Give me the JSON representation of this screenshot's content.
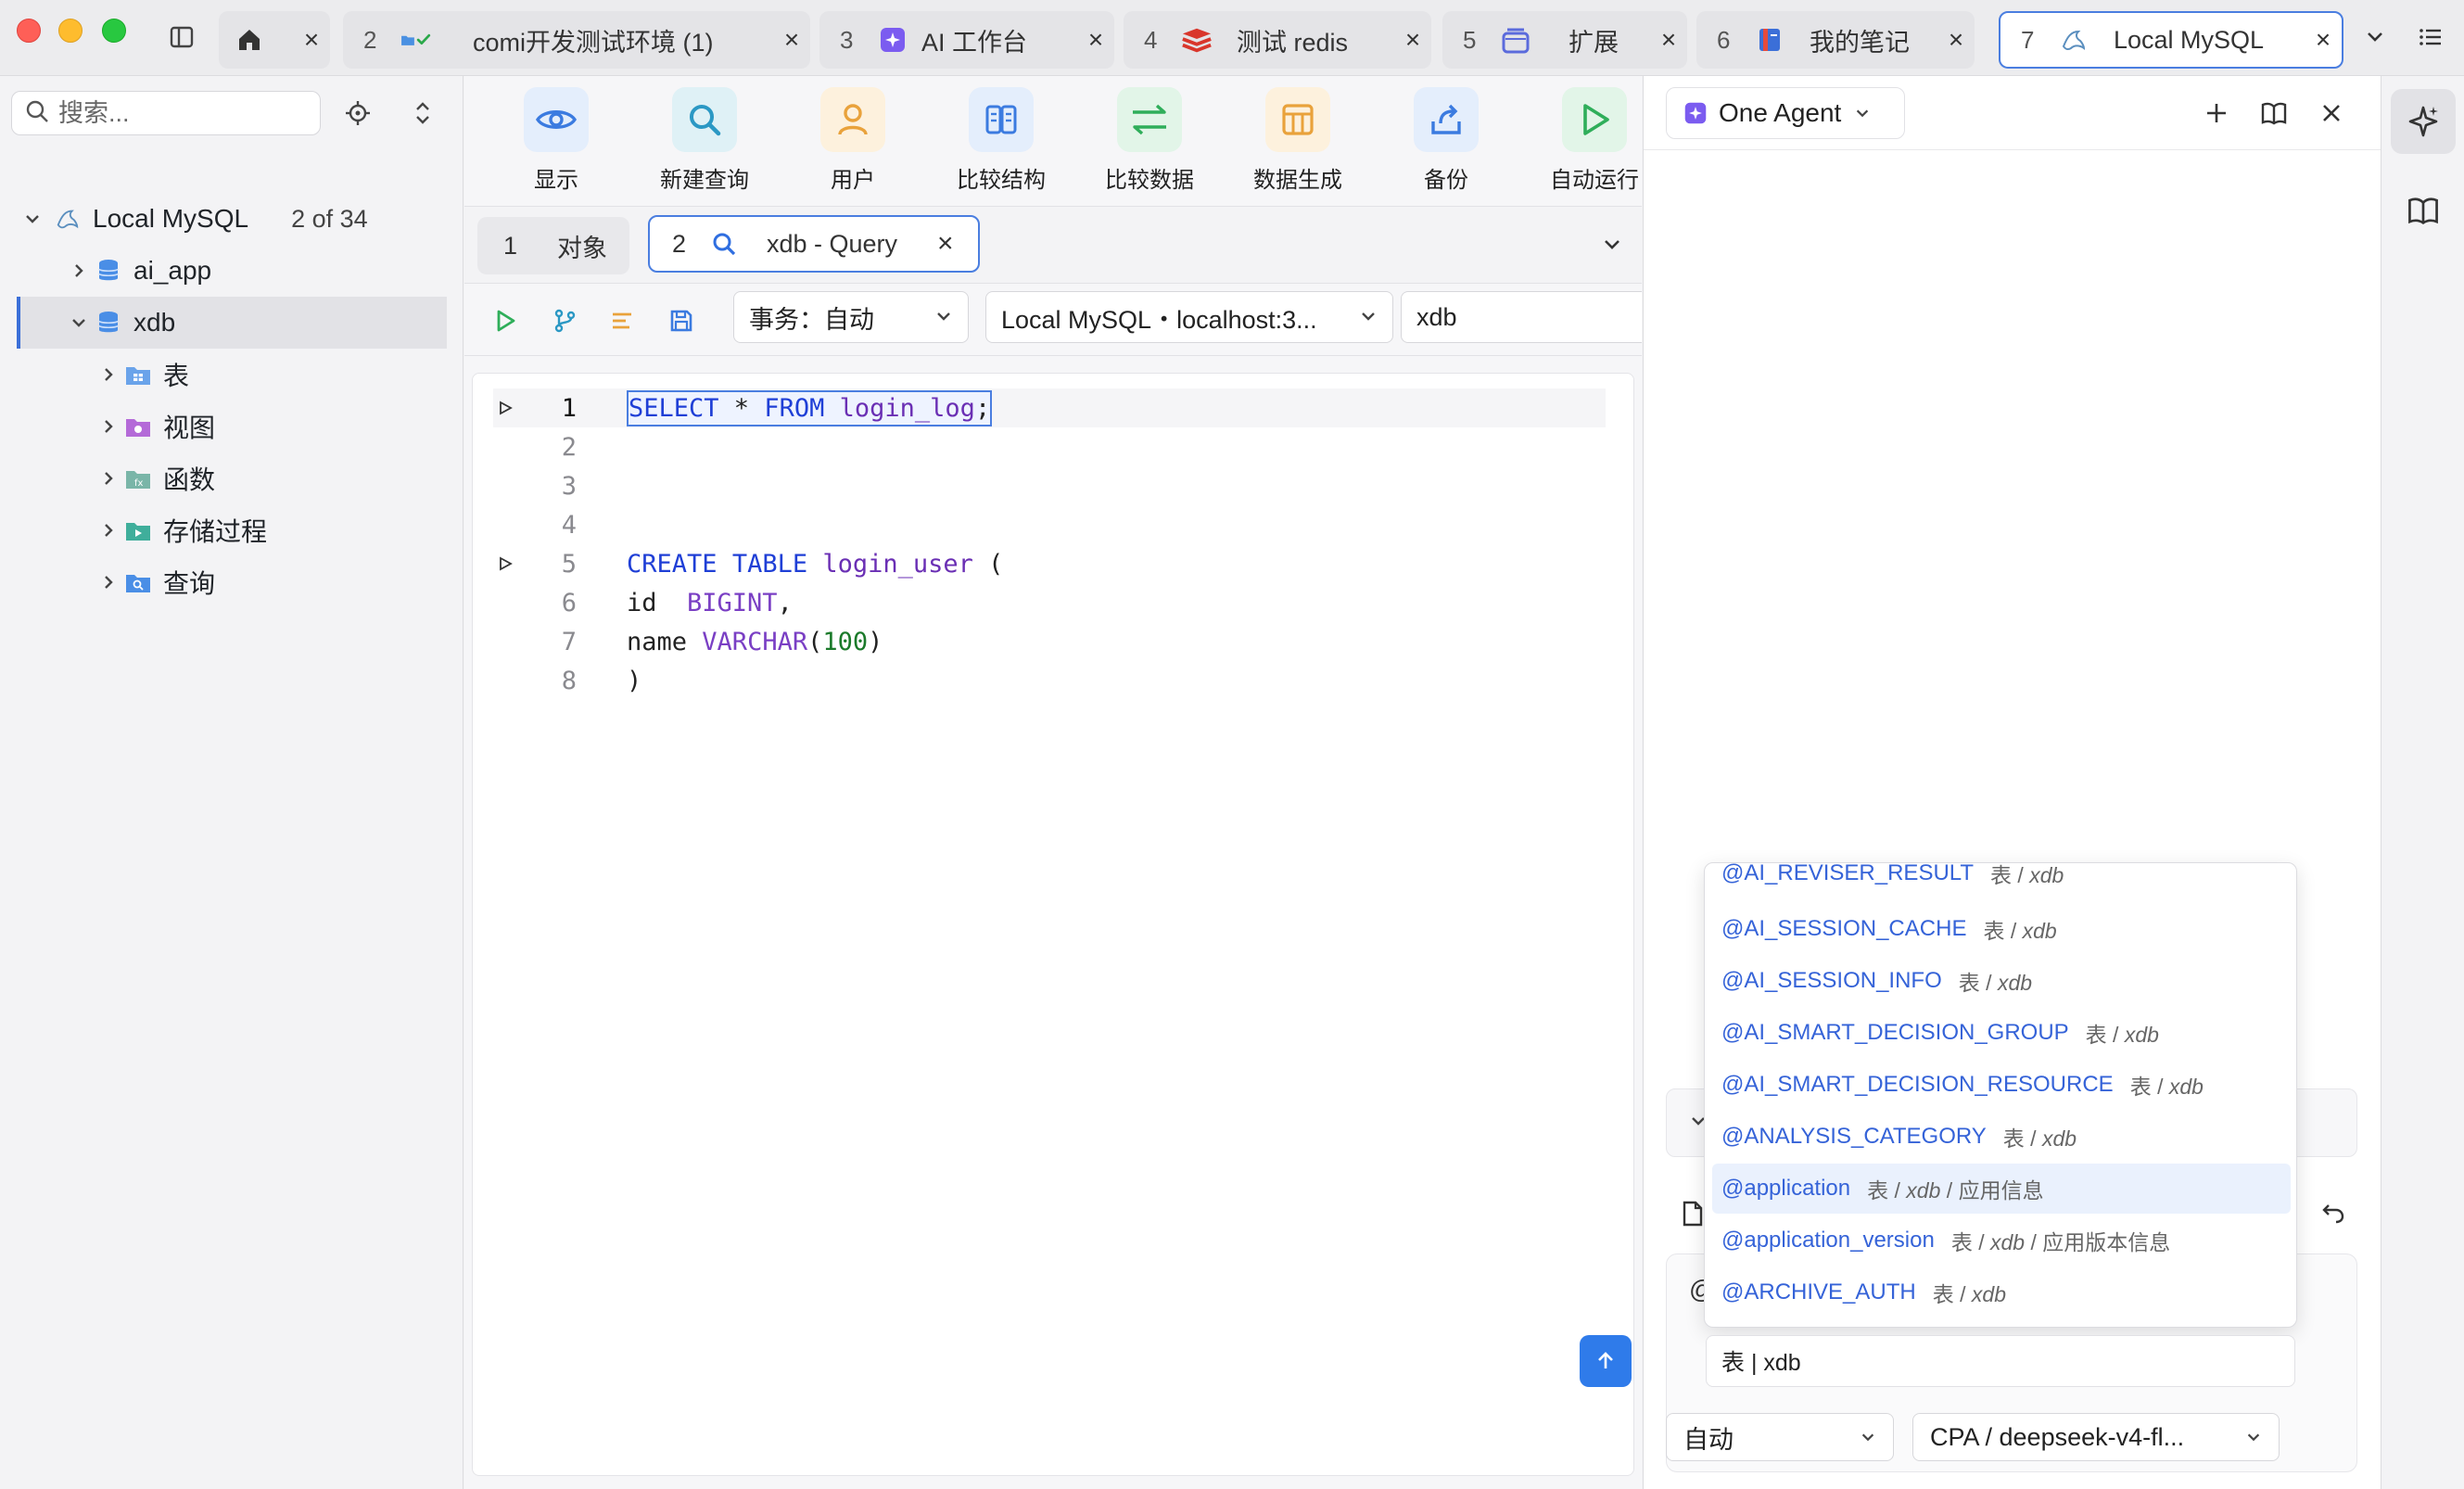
{
  "titlebar": {
    "tabs": [
      {
        "num": "",
        "label": "",
        "icon": "home-icon"
      },
      {
        "num": "2",
        "label": "comi开发测试环境 (1)",
        "icon": "folder-check-icon"
      },
      {
        "num": "3",
        "label": "AI 工作台",
        "icon": "ai-workbench-icon"
      },
      {
        "num": "4",
        "label": "测试 redis",
        "icon": "redis-icon"
      },
      {
        "num": "5",
        "label": "扩展",
        "icon": "extension-icon"
      },
      {
        "num": "6",
        "label": "我的笔记",
        "icon": "notebook-icon"
      },
      {
        "num": "7",
        "label": "Local MySQL",
        "icon": "mysql-icon"
      }
    ],
    "close_glyph": "×"
  },
  "sidebar": {
    "search_placeholder": "搜索...",
    "tree": {
      "root": {
        "label": "Local MySQL",
        "count": "2 of 34"
      },
      "databases": [
        {
          "label": "ai_app"
        },
        {
          "label": "xdb"
        }
      ],
      "xdb_children": [
        {
          "label": "表",
          "icon": "table-folder-icon"
        },
        {
          "label": "视图",
          "icon": "view-folder-icon"
        },
        {
          "label": "函数",
          "icon": "function-folder-icon"
        },
        {
          "label": "存储过程",
          "icon": "procedure-folder-icon"
        },
        {
          "label": "查询",
          "icon": "query-folder-icon"
        }
      ]
    }
  },
  "toolbar": {
    "items": [
      {
        "label": "显示",
        "icon": "eye-icon"
      },
      {
        "label": "新建查询",
        "icon": "search-icon"
      },
      {
        "label": "用户",
        "icon": "user-icon"
      },
      {
        "label": "比较结构",
        "icon": "compare-structure-icon"
      },
      {
        "label": "比较数据",
        "icon": "compare-data-icon"
      },
      {
        "label": "数据生成",
        "icon": "data-generate-icon"
      },
      {
        "label": "备份",
        "icon": "backup-icon"
      },
      {
        "label": "自动运行",
        "icon": "auto-run-icon"
      }
    ]
  },
  "subtabs": [
    {
      "num": "1",
      "label": "对象"
    },
    {
      "num": "2",
      "label": "xdb - Query"
    }
  ],
  "querybar": {
    "transaction": "事务：自动",
    "connection": "Local MySQL・localhost:3...",
    "database": "xdb"
  },
  "editor": {
    "current_line": "1",
    "line_numbers": [
      "1",
      "2",
      "3",
      "4",
      "5",
      "6",
      "7",
      "8"
    ],
    "line1": {
      "kw1": "SELECT",
      "star": " * ",
      "kw2": "FROM",
      "ident": "login_log",
      "end": ";"
    },
    "line5": {
      "kw1": "CREATE",
      "kw2": "TABLE",
      "ident": "login_user",
      "end": " ("
    },
    "line6": {
      "col": "id",
      "type": "BIGINT",
      "end": ","
    },
    "line7": {
      "col": "name",
      "type": "VARCHAR",
      "open": "(",
      "num": "100",
      "close": ")"
    },
    "line8": {
      "text": ")"
    }
  },
  "agent": {
    "agent_name": "One Agent",
    "mode": "自动",
    "model": "CPA / deepseek-v4-fl...",
    "status_line": "表 | xdb",
    "mention_items": [
      {
        "name": "@AI_REVISER_RESULT",
        "type": "表",
        "db": "xdb",
        "comment": ""
      },
      {
        "name": "@AI_SESSION_CACHE",
        "type": "表",
        "db": "xdb",
        "comment": ""
      },
      {
        "name": "@AI_SESSION_INFO",
        "type": "表",
        "db": "xdb",
        "comment": ""
      },
      {
        "name": "@AI_SMART_DECISION_GROUP",
        "type": "表",
        "db": "xdb",
        "comment": ""
      },
      {
        "name": "@AI_SMART_DECISION_RESOURCE",
        "type": "表",
        "db": "xdb",
        "comment": ""
      },
      {
        "name": "@ANALYSIS_CATEGORY",
        "type": "表",
        "db": "xdb",
        "comment": ""
      },
      {
        "name": "@application",
        "type": "表",
        "db": "xdb",
        "comment": "应用信息"
      },
      {
        "name": "@application_version",
        "type": "表",
        "db": "xdb",
        "comment": "应用版本信息"
      },
      {
        "name": "@ARCHIVE_AUTH",
        "type": "表",
        "db": "xdb",
        "comment": ""
      }
    ]
  }
}
